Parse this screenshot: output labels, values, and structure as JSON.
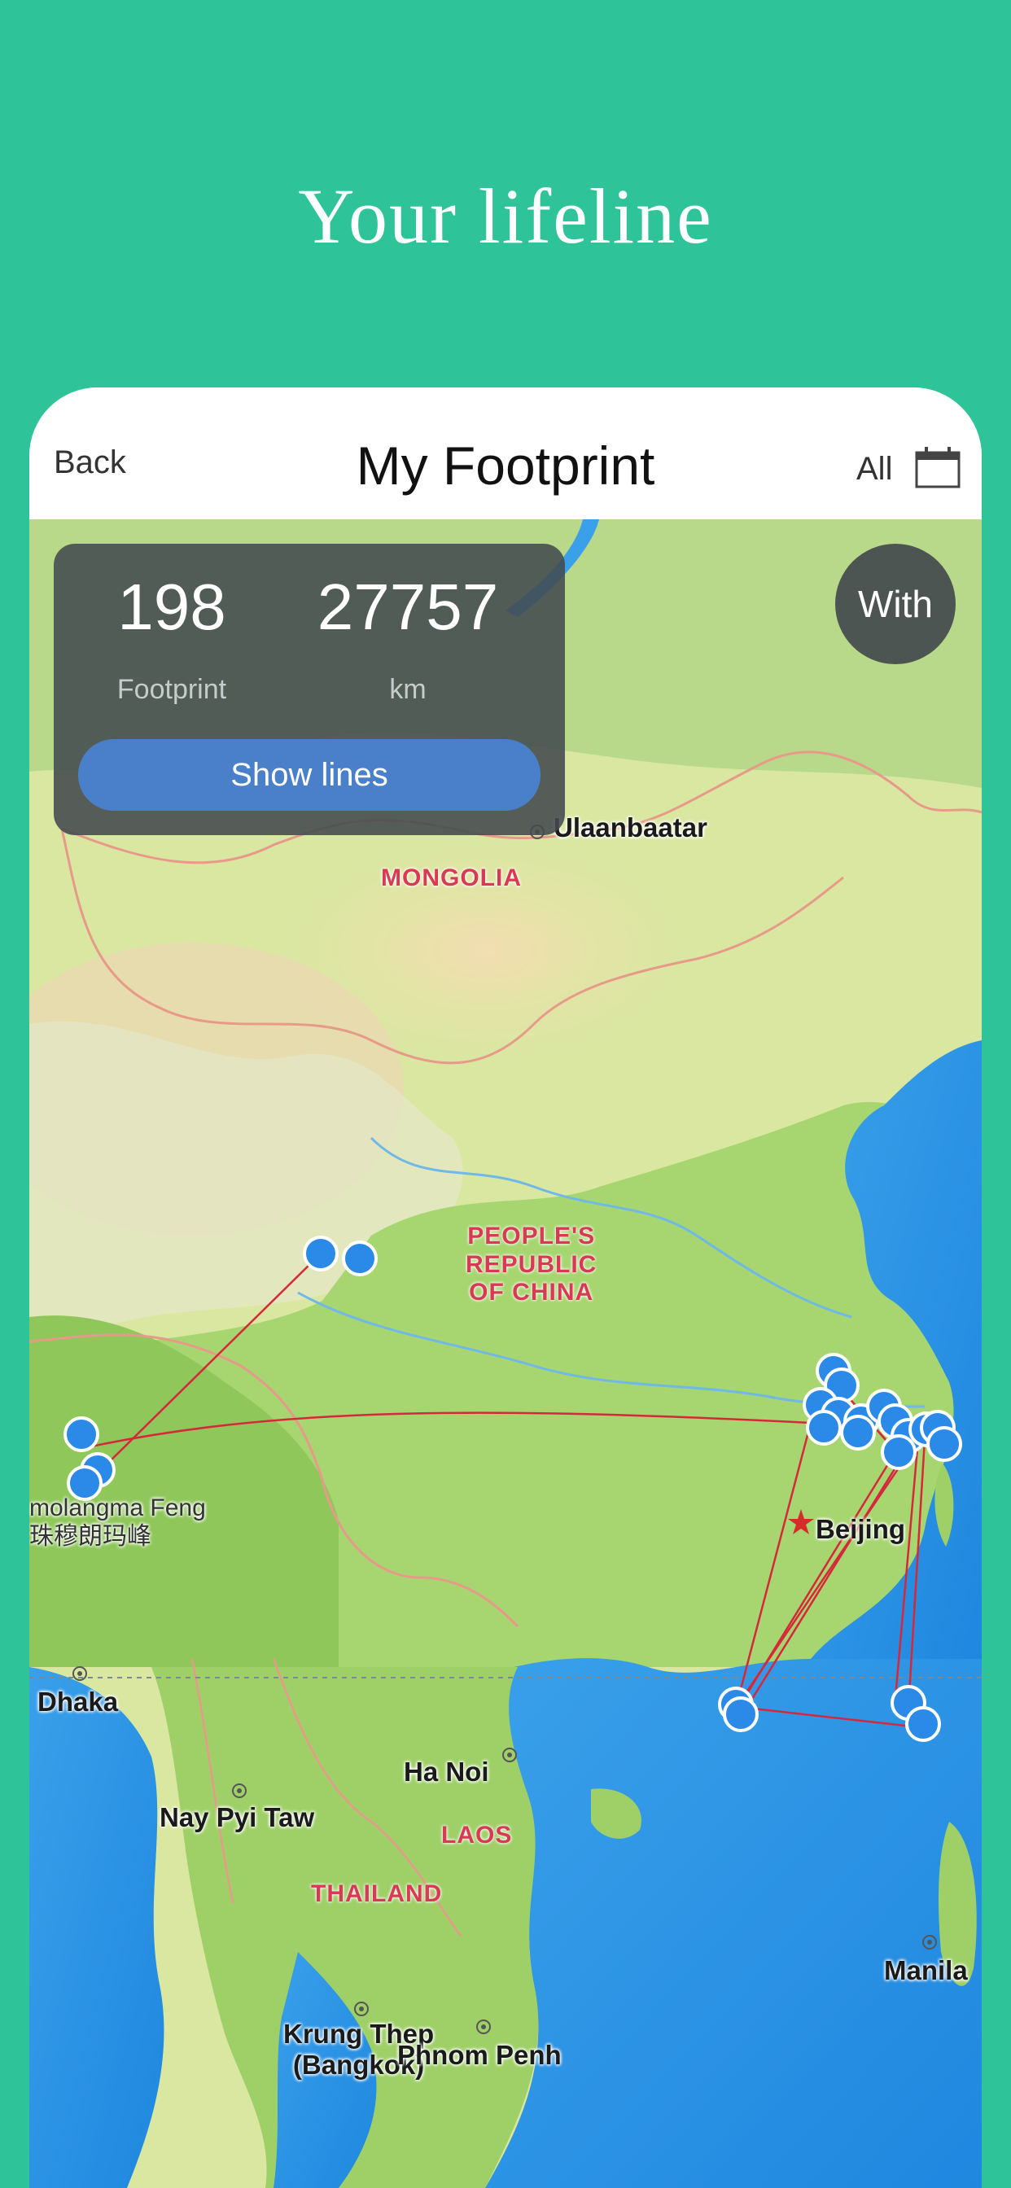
{
  "promo": {
    "title": "Your lifeline"
  },
  "navbar": {
    "back": "Back",
    "title": "My Footprint",
    "filter": "All",
    "calendar_icon": "calendar-icon"
  },
  "stats": {
    "footprint_value": "198",
    "footprint_label": "Footprint",
    "distance_value": "27757",
    "distance_label": "km",
    "show_lines": "Show lines"
  },
  "with_button": "With",
  "map_labels": {
    "ulaanbaatar": "Ulaanbaatar",
    "mongolia": "MONGOLIA",
    "beijing": "Beijing",
    "china": "PEOPLE'S\nREPUBLIC\nOF CHINA",
    "everest": "molangma Feng\n珠穆朗玛峰",
    "dhaka": "Dhaka",
    "hanoi": "Ha Noi",
    "naypyitaw": "Nay Pyi Taw",
    "laos": "LAOS",
    "thailand": "THAILAND",
    "bangkok": "Krung Thep\n(Bangkok)",
    "phnompenh": "Phnom Penh",
    "manila": "Manila"
  },
  "colors": {
    "background": "#2fc39a",
    "route": "#d6283b",
    "pin": "#2b8ae8",
    "button": "#4a80c9"
  }
}
